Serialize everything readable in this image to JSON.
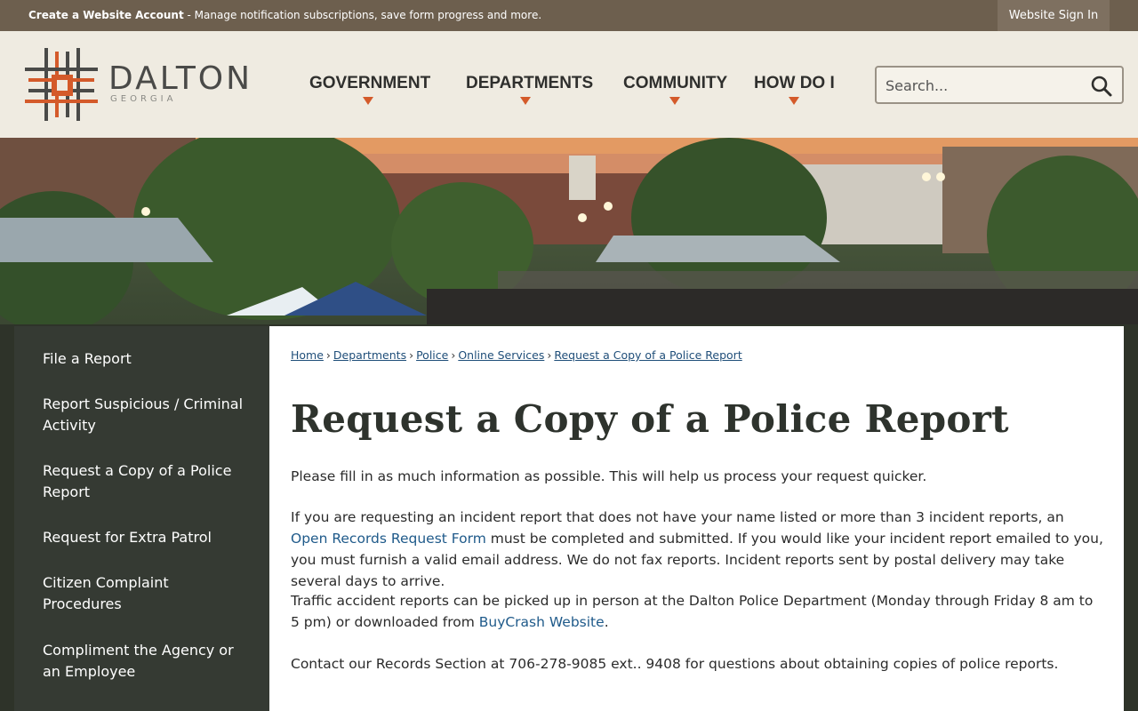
{
  "topbar": {
    "account_link": "Create a Website Account",
    "account_desc": " - Manage notification subscriptions, save form progress and more.",
    "sign_in": "Website Sign In"
  },
  "logo": {
    "name": "DALTON",
    "sub": "GEORGIA"
  },
  "nav": {
    "items": [
      {
        "label": "GOVERNMENT"
      },
      {
        "label": "DEPARTMENTS"
      },
      {
        "label": "COMMUNITY"
      },
      {
        "label": "HOW DO I"
      }
    ]
  },
  "search": {
    "placeholder": "Search..."
  },
  "sidebar": {
    "items": [
      {
        "label": "File a Report"
      },
      {
        "label": "Report Suspicious / Criminal Activity"
      },
      {
        "label": "Request a Copy of a Police Report"
      },
      {
        "label": "Request for Extra Patrol"
      },
      {
        "label": "Citizen Complaint Procedures"
      },
      {
        "label": "Compliment the Agency or an Employee"
      }
    ]
  },
  "breadcrumb": [
    "Home",
    "Departments",
    "Police",
    "Online Services",
    "Request a Copy of a Police Report"
  ],
  "main": {
    "title": "Request a Copy of a Police Report",
    "p1": "Please fill in as much information as possible. This will help us process your request quicker.",
    "p2_a": "If you are requesting an incident report that does not have your name listed or more than 3 incident reports, an ",
    "p2_link": "Open Records Request Form",
    "p2_b": " must be completed and submitted. If you would like your incident report emailed to you, you must furnish a valid email address. We do not fax reports. Incident reports sent by postal delivery may take several days to arrive.",
    "p3_a": "Traffic accident reports can be picked up in person at the Dalton Police Department (Monday through Friday 8 am to 5 pm) or downloaded from ",
    "p3_link": "BuyCrash Website",
    "p3_b": ".",
    "p4": "Contact our Records Section at 706-278-9085 ext.. 9408 for questions about obtaining copies of police reports."
  },
  "colors": {
    "topbar": "#6d5f4e",
    "header_bg": "#efebe1",
    "accent_orange": "#d45a2a",
    "sidebar_bg": "#353a33",
    "link": "#1f5a8a"
  }
}
